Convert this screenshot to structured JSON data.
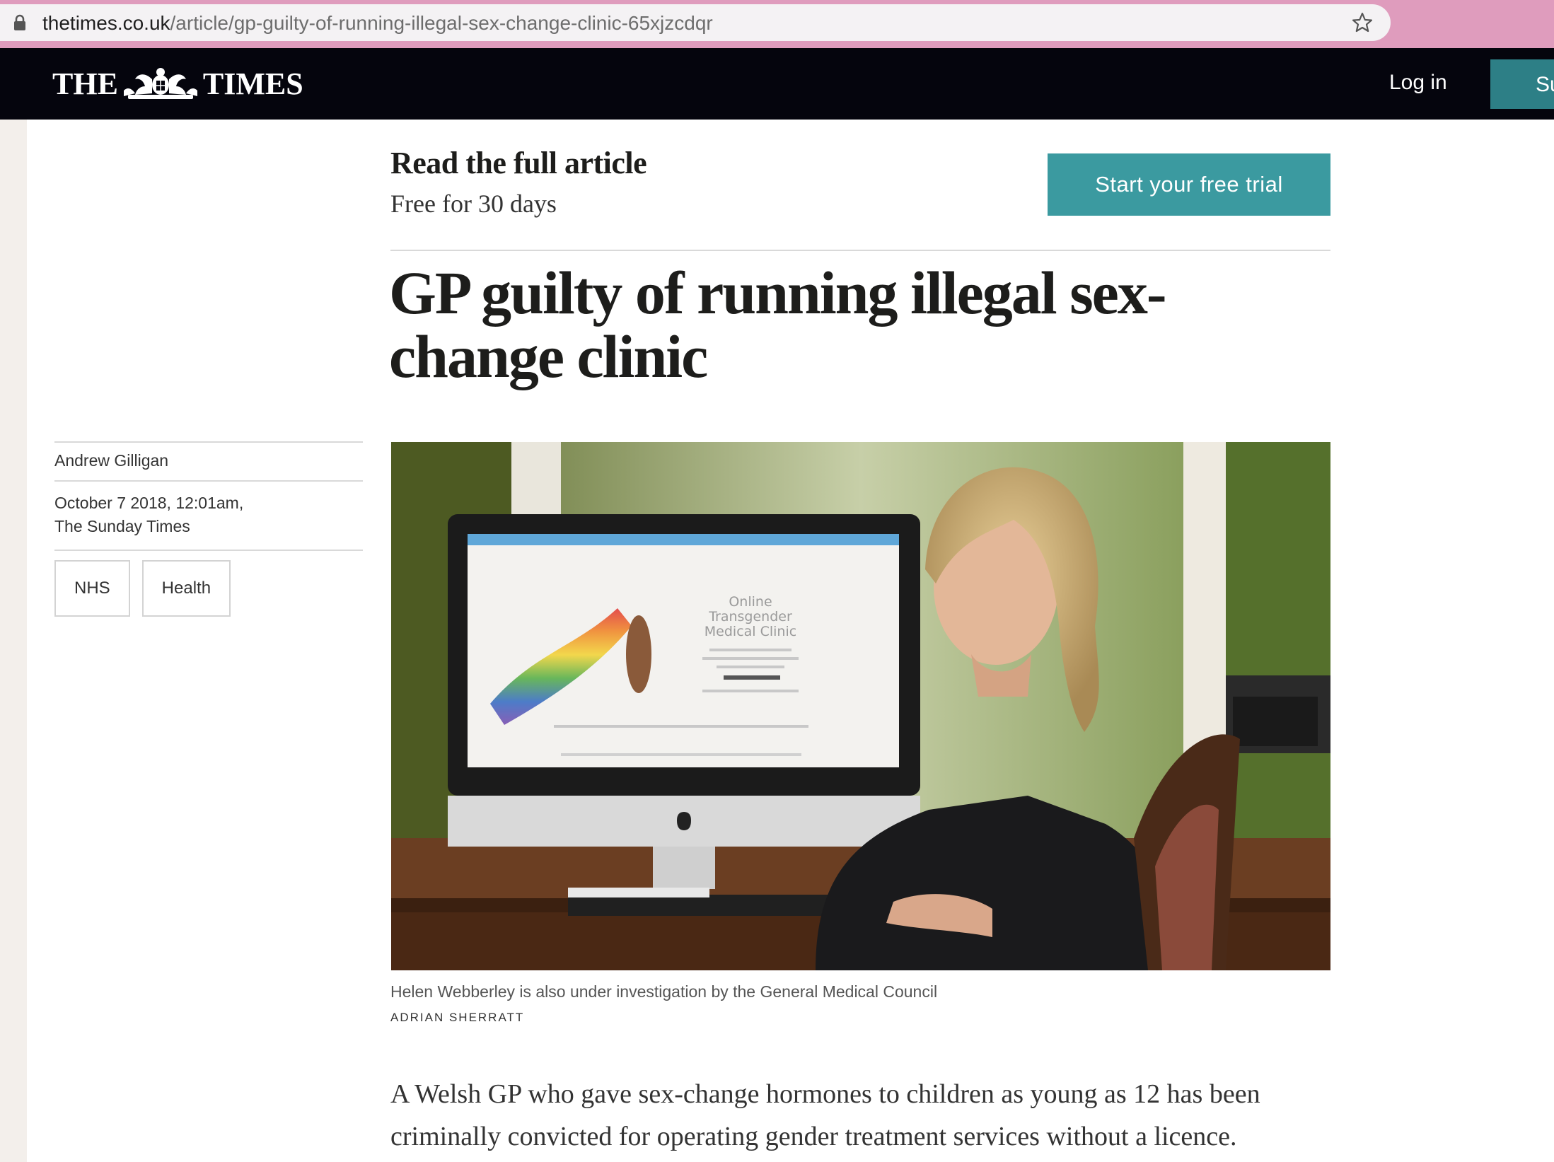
{
  "browser": {
    "url_host": "thetimes.co.uk",
    "url_path": "/article/gp-guilty-of-running-illegal-sex-change-clinic-65xjzcdqr"
  },
  "masthead": {
    "logo_left": "THE",
    "logo_right": "TIMES",
    "login_label": "Log in",
    "subscribe_label": "Su"
  },
  "promo": {
    "title": "Read the full article",
    "subtitle": "Free for 30 days",
    "trial_button": "Start your free trial"
  },
  "article": {
    "headline": "GP guilty of running illegal sex-change clinic",
    "author": "Andrew Gilligan",
    "date": "October 7 2018, 12:01am,",
    "publication": "The Sunday Times",
    "tags": [
      "NHS",
      "Health"
    ],
    "image": {
      "screen_title_1": "Online",
      "screen_title_2": "Transgender",
      "screen_title_3": "Medical Clinic",
      "caption": "Helen Webberley is also under investigation by the General Medical Council",
      "credit": "ADRIAN SHERRATT"
    },
    "lead": "A Welsh GP who gave sex-change hormones to children as young as 12 has been criminally convicted for operating gender treatment services without a licence."
  }
}
